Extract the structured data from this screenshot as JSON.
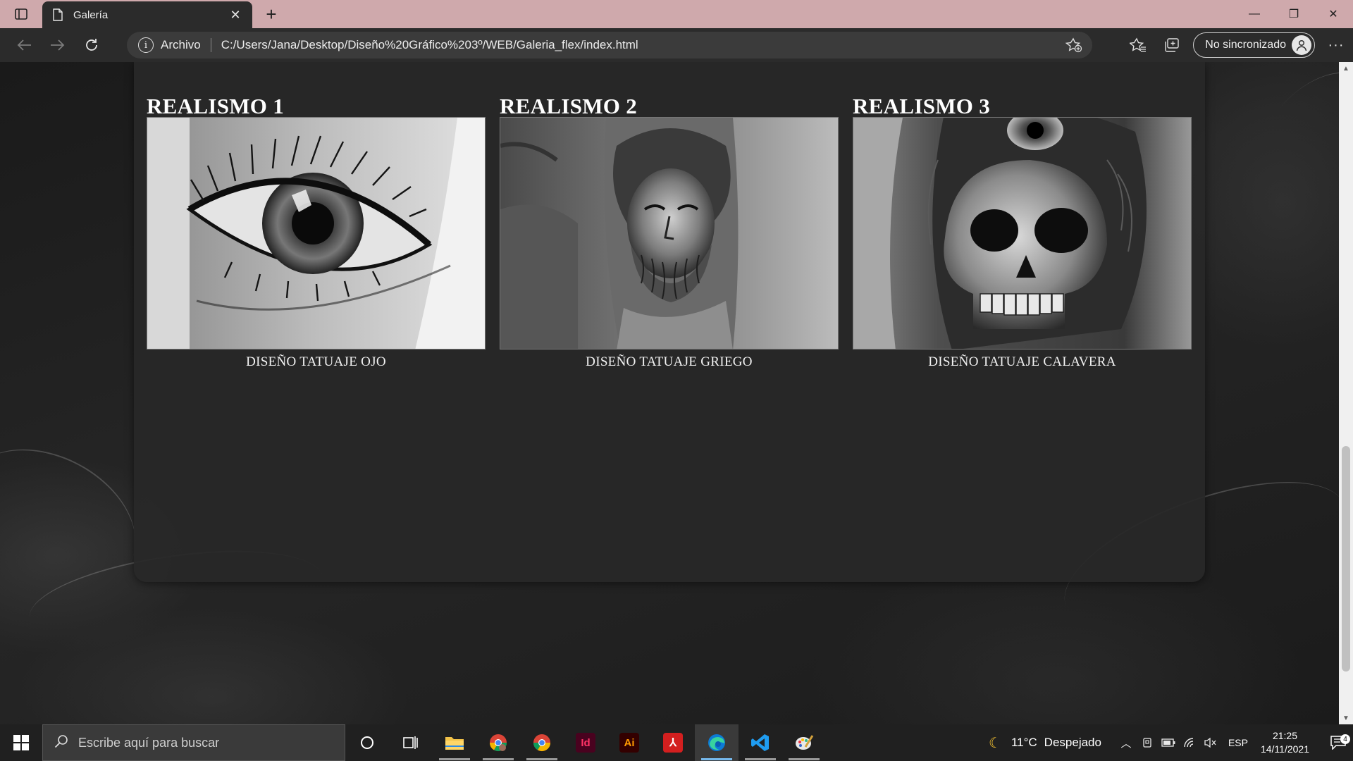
{
  "browser": {
    "tab_title": "Galería",
    "address_scheme_label": "Archivo",
    "url": "C:/Users/Jana/Desktop/Diseño%20Gráfico%203º/WEB/Galeria_flex/index.html",
    "profile_label": "No sincronizado"
  },
  "gallery": {
    "items": [
      {
        "title": "REALISMO 1",
        "caption": "DISEÑO TATUAJE OJO",
        "image": "eye-tattoo"
      },
      {
        "title": "REALISMO 2",
        "caption": "DISEÑO TATUAJE GRIEGO",
        "image": "greek-statue-tattoo"
      },
      {
        "title": "REALISMO 3",
        "caption": "DISEÑO TATUAJE CALAVERA",
        "image": "skull-owl-tattoo"
      }
    ]
  },
  "taskbar": {
    "search_placeholder": "Escribe aquí para buscar",
    "weather_temp": "11°C",
    "weather_desc": "Despejado",
    "language": "ESP",
    "time": "21:25",
    "date": "14/11/2021",
    "notification_count": "4",
    "apps": [
      "cortana",
      "task-view",
      "file-explorer",
      "chrome-alt",
      "chrome",
      "indesign",
      "illustrator",
      "acrobat",
      "edge",
      "vscode",
      "paint"
    ]
  },
  "colors": {
    "titlebar": "#cfa9ac",
    "toolbar": "#2b2b2b",
    "panel": "#282828",
    "taskbar": "#202020"
  }
}
